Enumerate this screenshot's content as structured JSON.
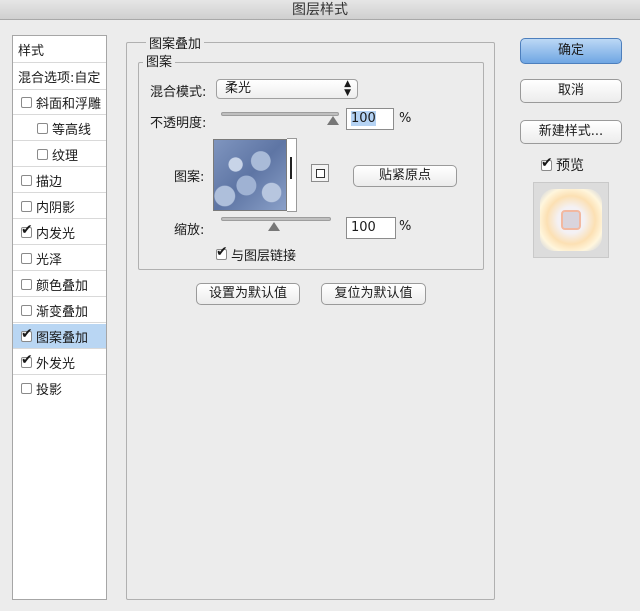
{
  "window": {
    "title": "图层样式"
  },
  "style_list": {
    "header": "样式",
    "blend_options": "混合选项:自定",
    "items": [
      {
        "label": "斜面和浮雕",
        "checked": false,
        "indent": false,
        "selected": false
      },
      {
        "label": "等高线",
        "checked": false,
        "indent": true,
        "selected": false
      },
      {
        "label": "纹理",
        "checked": false,
        "indent": true,
        "selected": false
      },
      {
        "label": "描边",
        "checked": false,
        "indent": false,
        "selected": false
      },
      {
        "label": "内阴影",
        "checked": false,
        "indent": false,
        "selected": false
      },
      {
        "label": "内发光",
        "checked": true,
        "indent": false,
        "selected": false
      },
      {
        "label": "光泽",
        "checked": false,
        "indent": false,
        "selected": false
      },
      {
        "label": "颜色叠加",
        "checked": false,
        "indent": false,
        "selected": false
      },
      {
        "label": "渐变叠加",
        "checked": false,
        "indent": false,
        "selected": false
      },
      {
        "label": "图案叠加",
        "checked": true,
        "indent": false,
        "selected": true
      },
      {
        "label": "外发光",
        "checked": true,
        "indent": false,
        "selected": false
      },
      {
        "label": "投影",
        "checked": false,
        "indent": false,
        "selected": false
      }
    ]
  },
  "panel": {
    "group_title": "图案叠加",
    "subgroup_title": "图案",
    "blend_mode_label": "混合模式:",
    "blend_mode_value": "柔光",
    "opacity_label": "不透明度:",
    "opacity_value": "100",
    "opacity_unit": "%",
    "pattern_label": "图案:",
    "snap_origin_button": "贴紧原点",
    "scale_label": "缩放:",
    "scale_value": "100",
    "scale_unit": "%",
    "link_with_layer_label": "与图层链接",
    "link_with_layer_checked": true,
    "make_default_button": "设置为默认值",
    "reset_default_button": "复位为默认值"
  },
  "actions": {
    "ok": "确定",
    "cancel": "取消",
    "new_style": "新建样式...",
    "preview_label": "预览",
    "preview_checked": true
  },
  "colors": {
    "selection": "#b9d6f3",
    "default_button": "#6fa6e3"
  }
}
